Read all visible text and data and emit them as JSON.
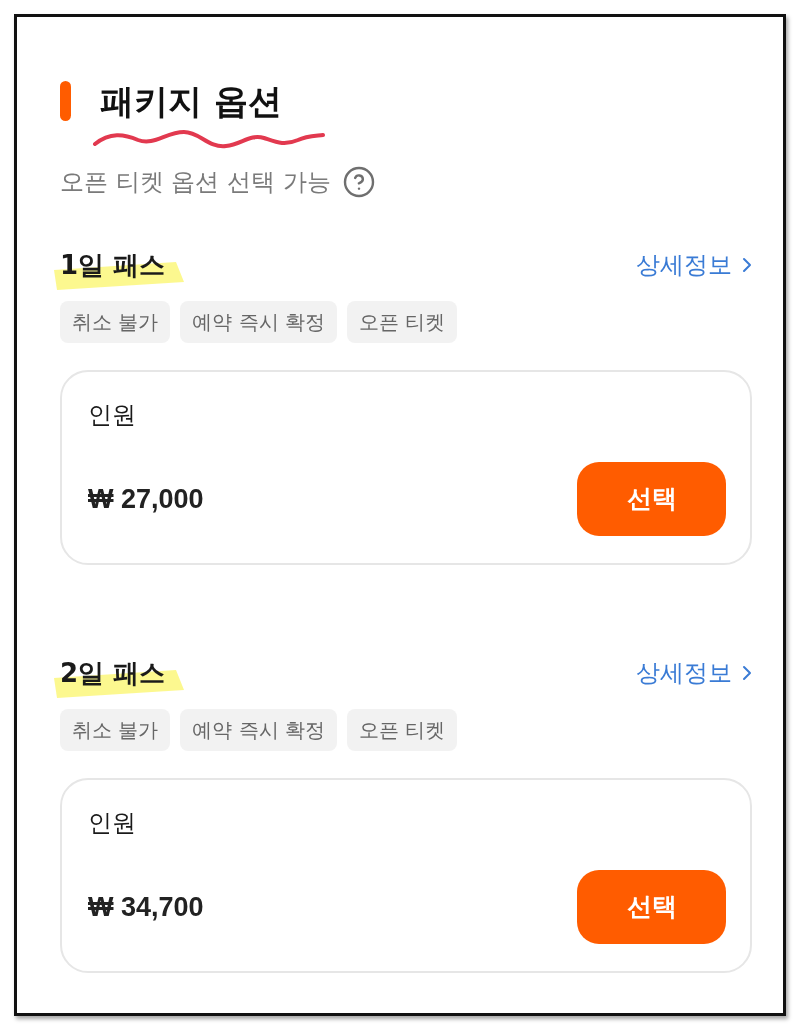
{
  "header": {
    "title": "패키지 옵션",
    "title_underlined": true,
    "subtitle": "오픈 티켓 옵션 선택 가능"
  },
  "packages": [
    {
      "name": "1일 패스",
      "highlighted": true,
      "detail_link": "상세정보",
      "tags": [
        "취소 불가",
        "예약 즉시 확정",
        "오픈 티켓"
      ],
      "option": {
        "label": "인원",
        "price": "₩ 27,000",
        "button": "선택"
      }
    },
    {
      "name": "2일 패스",
      "highlighted": true,
      "detail_link": "상세정보",
      "tags": [
        "취소 불가",
        "예약 즉시 확정",
        "오픈 티켓"
      ],
      "option": {
        "label": "인원",
        "price": "₩ 34,700",
        "button": "선택"
      }
    }
  ]
}
